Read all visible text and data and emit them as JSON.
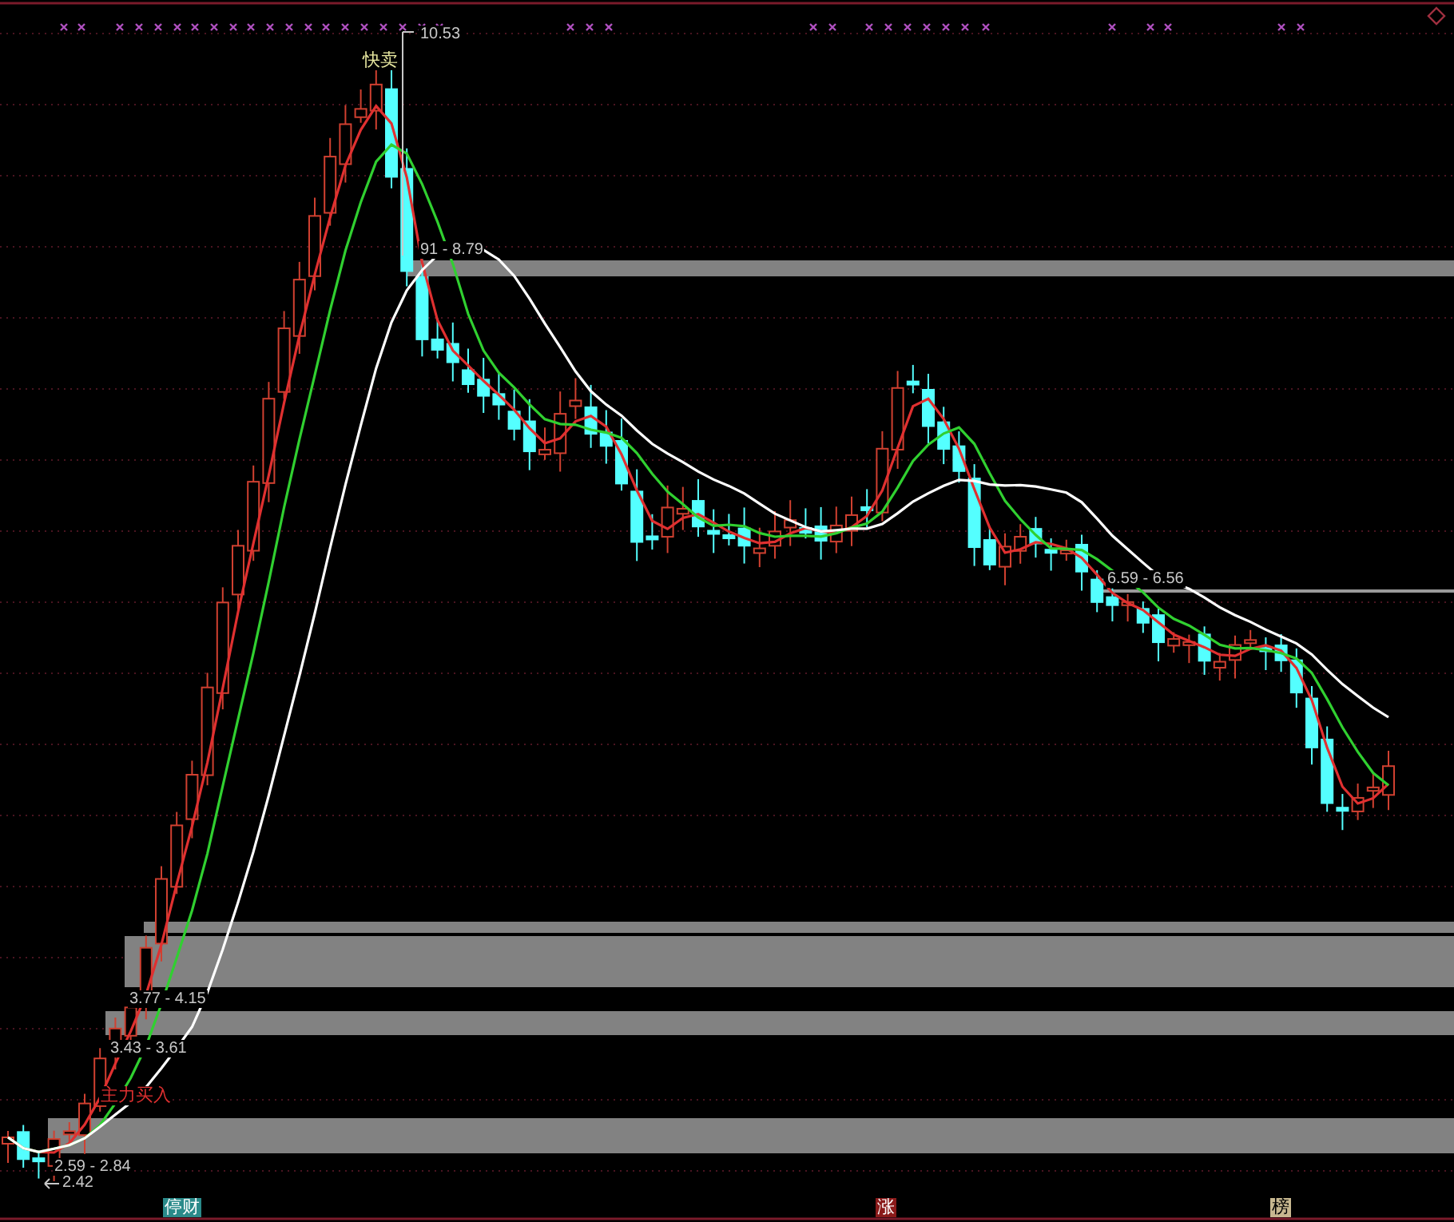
{
  "chart": {
    "price_labels": [
      {
        "text": "10.53"
      },
      {
        "text": "91 - 8.79"
      },
      {
        "text": "6.59 - 6.56"
      },
      {
        "text": "3.77 - 4.15"
      },
      {
        "text": "3.43 - 3.61"
      },
      {
        "text": "2.59 - 2.84"
      },
      {
        "text": "2.42"
      }
    ],
    "signals": [
      {
        "text": "快卖",
        "kind": "sell"
      },
      {
        "text": "主力买入",
        "kind": "buy"
      }
    ],
    "bottom_tags": [
      {
        "text": "停财",
        "color": "#2a8a8a"
      },
      {
        "text": "涨",
        "color": "#8a1a1a"
      },
      {
        "text": "榜",
        "color": "#c8b890"
      }
    ]
  }
}
